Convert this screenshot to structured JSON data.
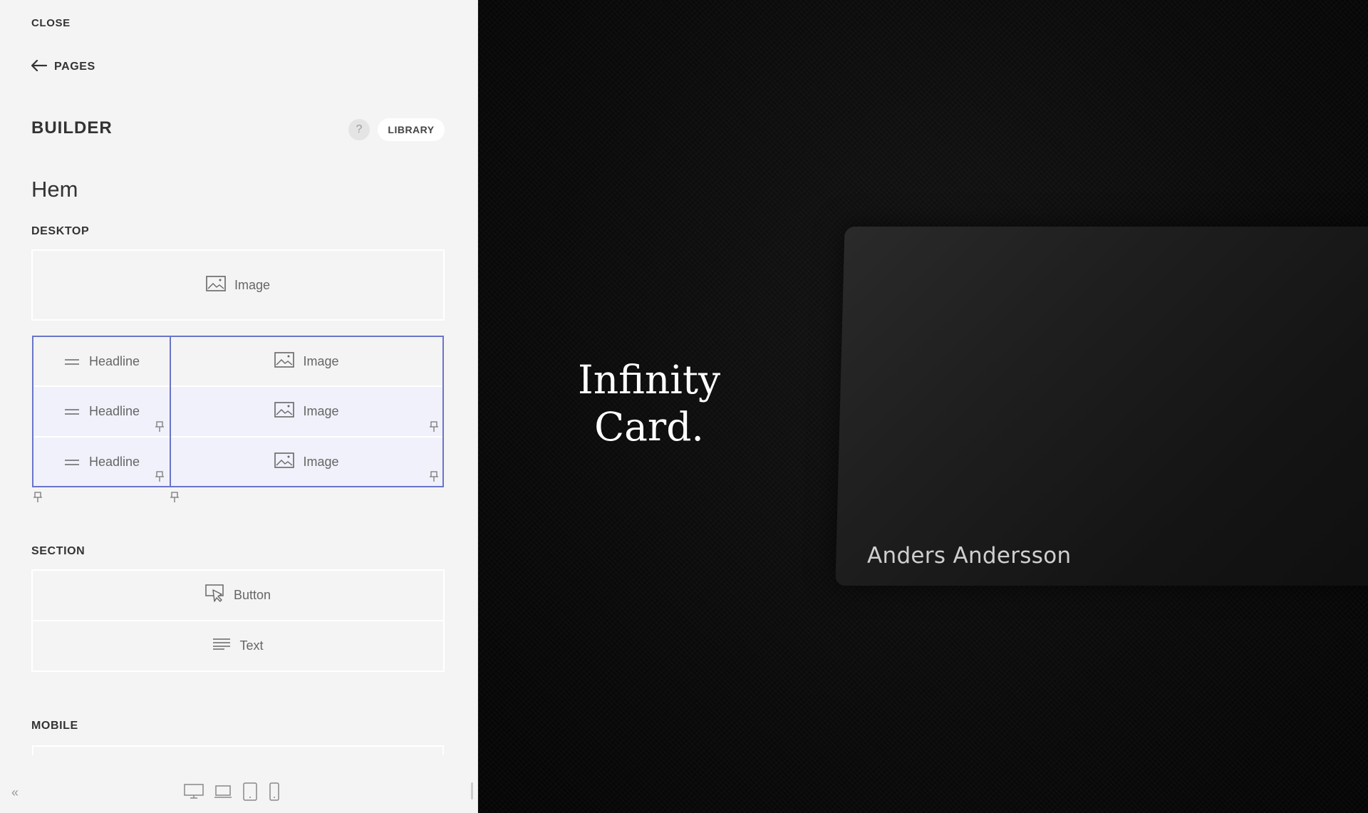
{
  "sidebar": {
    "close_label": "CLOSE",
    "pages_label": "PAGES",
    "builder_title": "BUILDER",
    "help_label": "?",
    "library_label": "LIBRARY",
    "page_name": "Hem",
    "desktop_label": "DESKTOP",
    "section_label": "SECTION",
    "mobile_label": "MOBILE",
    "desktop_blocks": {
      "image_block": "Image",
      "grid_rows": [
        {
          "left": "Headline",
          "right": "Image"
        },
        {
          "left": "Headline",
          "right": "Image"
        },
        {
          "left": "Headline",
          "right": "Image"
        }
      ]
    },
    "section_blocks": {
      "button_block": "Button",
      "text_block": "Text"
    },
    "collapse_label": "«",
    "accent_color": "#6a74c9"
  },
  "preview": {
    "hero_line1": "Infinity",
    "hero_line2": "Card.",
    "card_name": "Anders Andersson"
  }
}
